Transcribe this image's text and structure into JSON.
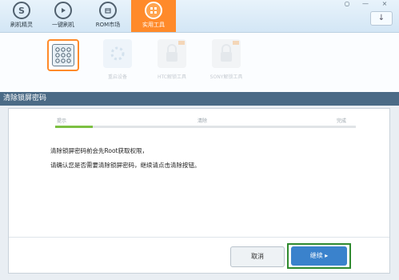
{
  "nav": {
    "items": [
      {
        "label": "刷机精灵",
        "icon": "s-logo-icon"
      },
      {
        "label": "一键刷机",
        "icon": "play-icon"
      },
      {
        "label": "ROM市场",
        "icon": "box-icon"
      },
      {
        "label": "实用工具",
        "icon": "grid-icon",
        "active": true
      }
    ],
    "window_controls": [
      "○",
      "—",
      "×"
    ],
    "right_button": "↓"
  },
  "tools": [
    {
      "label": "",
      "icon": "pattern-lock-icon",
      "selected": true
    },
    {
      "label": "重启设备",
      "icon": "restart-icon"
    },
    {
      "label": "HTC解锁工具",
      "icon": "htc-lock-icon"
    },
    {
      "label": "SONY解锁工具",
      "icon": "sony-lock-icon"
    }
  ],
  "section": {
    "title": "清除锁屏密码"
  },
  "steps": {
    "labels": [
      "提示",
      "清除",
      "完成"
    ],
    "progress": 0.125
  },
  "message": {
    "line1": "清除锁屏密码前会先Root获取权限，",
    "line2": "请确认您是否需要清除锁屏密码，继续请点击清除按钮。"
  },
  "buttons": {
    "cancel": "取消",
    "continue": "继续 ▸"
  },
  "colors": {
    "accent": "#ff8a2a",
    "primary": "#3a82cc",
    "section_bar": "#4b6b86",
    "progress": "#7cc042",
    "highlight": "#2f8a2f"
  }
}
